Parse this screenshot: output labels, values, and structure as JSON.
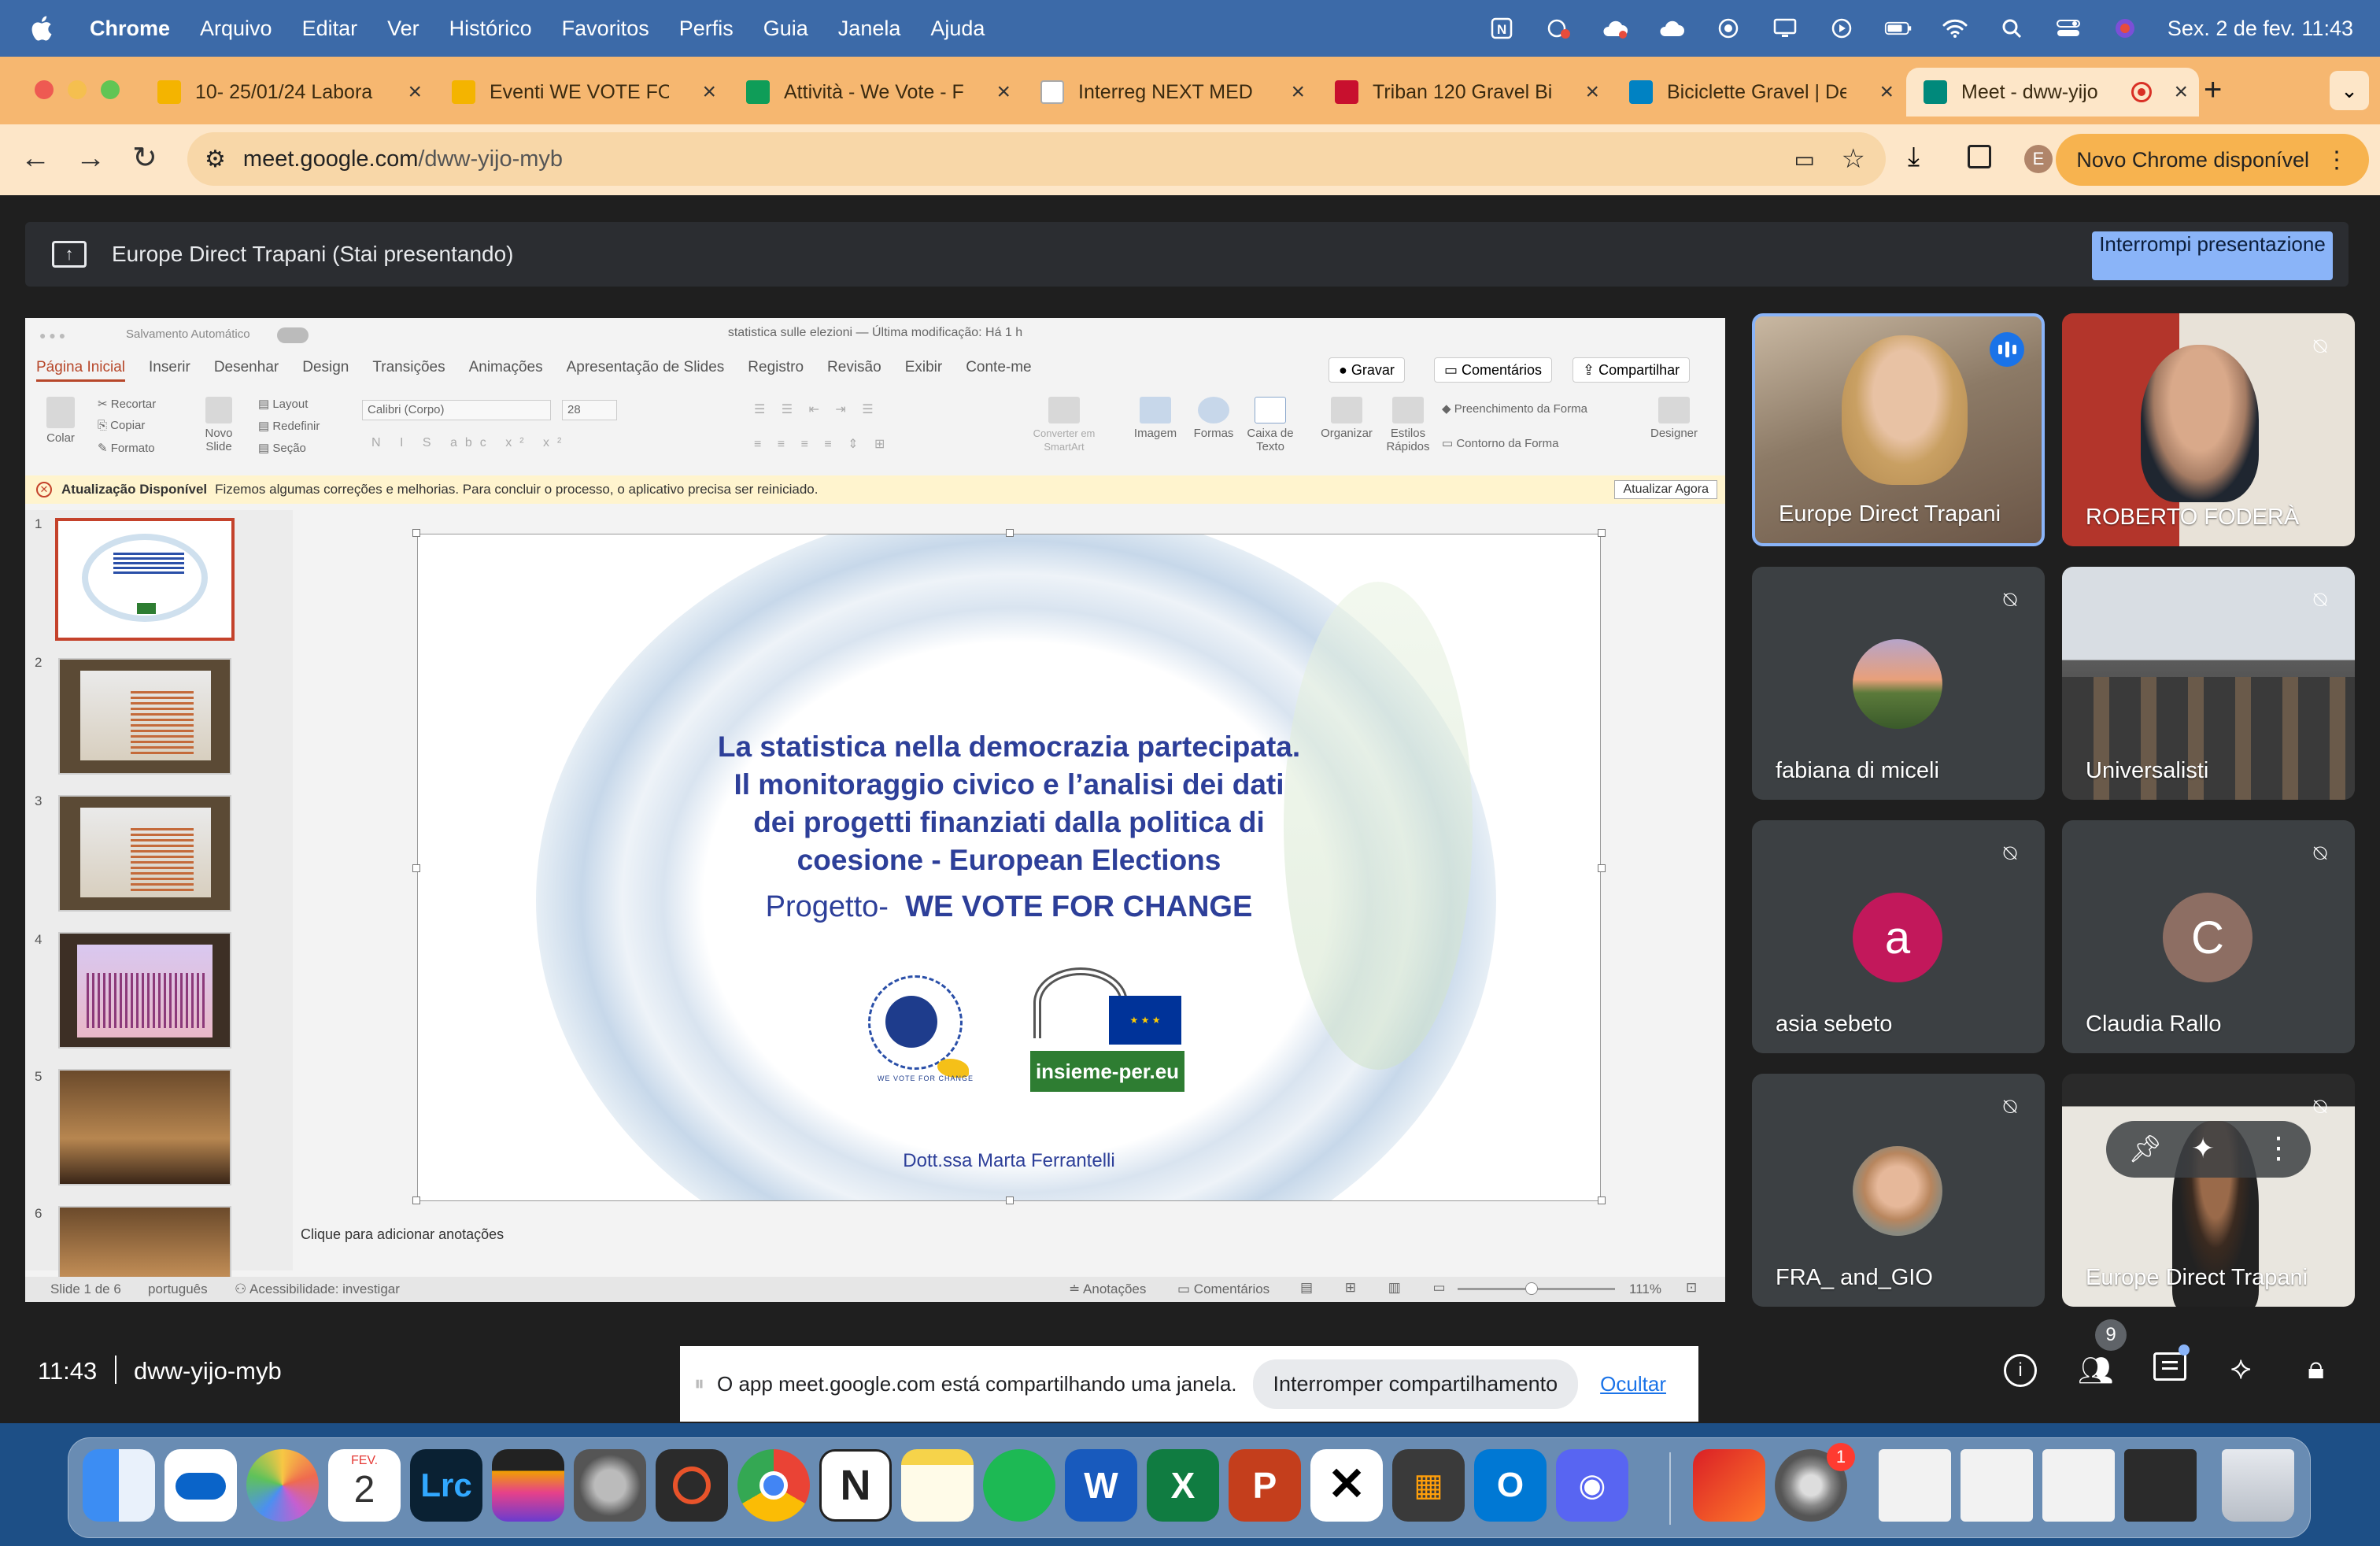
{
  "menubar": {
    "app": "Chrome",
    "items": [
      "Arquivo",
      "Editar",
      "Ver",
      "Histórico",
      "Favoritos",
      "Perfis",
      "Guia",
      "Janela",
      "Ajuda"
    ],
    "clock": "Sex. 2 de fev.  11:43"
  },
  "tabs": [
    {
      "title": "10- 25/01/24 Labora",
      "icon": "google-drive-icon",
      "color": "#f4b400"
    },
    {
      "title": "Eventi WE VOTE FOR",
      "icon": "google-drive-icon",
      "color": "#f4b400"
    },
    {
      "title": "Attività - We Vote - F",
      "icon": "google-sheets-icon",
      "color": "#0f9d58"
    },
    {
      "title": "Interreg NEXT MED",
      "icon": "web-icon",
      "color": "#dddddd"
    },
    {
      "title": "Triban 120 Gravel Bi",
      "icon": "brand-icon",
      "color": "#c8102e"
    },
    {
      "title": "Biciclette Gravel | De",
      "icon": "decathlon-icon",
      "color": "#0082c3"
    },
    {
      "title": "Meet - dww-yijo",
      "icon": "google-meet-icon",
      "color": "#00897b"
    }
  ],
  "address": {
    "host": "meet.google.com",
    "path": "/dww-yijo-myb"
  },
  "profile_initial": "E",
  "new_chrome": "Novo Chrome disponível",
  "presenting": {
    "label": "Europe Direct Trapani (Stai presentando)",
    "stop": "Interrompi presentazione"
  },
  "ppt": {
    "autosave": "Salvamento Automático",
    "title": "statistica sulle elezioni — Última modificação: Há 1 h",
    "tabs": [
      "Página Inicial",
      "Inserir",
      "Desenhar",
      "Design",
      "Transições",
      "Animações",
      "Apresentação de Slides",
      "Registro",
      "Revisão",
      "Exibir",
      "Conte-me"
    ],
    "gravar": "Gravar",
    "comentarios": "Comentários",
    "compartilhar": "Compartilhar",
    "ribbon": {
      "colar": "Colar",
      "recortar": "Recortar",
      "copiar": "Copiar",
      "formato": "Formato",
      "novo_slide": "Novo Slide",
      "layout": "Layout",
      "redefinir": "Redefinir",
      "secao": "Seção",
      "font": "Calibri (Corpo)",
      "size": "28",
      "converter": "Converter em SmartArt",
      "imagem": "Imagem",
      "formas": "Formas",
      "caixa": "Caixa de Texto",
      "organizar": "Organizar",
      "estilos": "Estilos Rápidos",
      "preenchimento": "Preenchimento da Forma",
      "contorno": "Contorno da Forma",
      "designer": "Designer"
    },
    "update_title": "Atualização Disponível",
    "update_msg": "Fizemos algumas correções e melhorias. Para concluir o processo, o aplicativo precisa ser reiniciado.",
    "update_btn": "Atualizar Agora",
    "thumb_nums": [
      "1",
      "2",
      "3",
      "4",
      "5",
      "6"
    ],
    "slide": {
      "line1": "La statistica nella democrazia partecipata.",
      "line2": "Il monitoraggio civico e l’analisi dei dati",
      "line3": "dei progetti finanziati dalla politica di",
      "line4": "coesione - European Elections",
      "progetto": "Progetto-",
      "project_name": "WE VOTE FOR CHANGE",
      "logo1": "WE VOTE FOR CHANGE",
      "logo2": "insieme-per.eu",
      "author": "Dott.ssa Marta Ferrantelli"
    },
    "notes": "Clique para adicionar anotações",
    "status": {
      "slide": "Slide 1 de 6",
      "lang": "português",
      "access": "Acessibilidade: investigar",
      "notes": "Anotações",
      "comments": "Comentários",
      "zoom": "111%"
    }
  },
  "participants": [
    {
      "name": "Europe Direct Trapani",
      "speaking": true
    },
    {
      "name": "ROBERTO FODERÀ"
    },
    {
      "name": "fabiana di miceli"
    },
    {
      "name": "Universalisti"
    },
    {
      "name": "asia sebeto",
      "initial": "a",
      "color": "#c2185b"
    },
    {
      "name": "Claudia Rallo",
      "initial": "C",
      "color": "#8d6e63"
    },
    {
      "name": "FRA_ and_GIO"
    },
    {
      "name": "Europe Direct Trapani"
    }
  ],
  "meeting": {
    "time": "11:43",
    "code": "dww-yijo-myb",
    "people_count": "9"
  },
  "share_notice": {
    "text": "O app meet.google.com está compartilhando uma janela.",
    "stop": "Interromper compartilhamento",
    "hide": "Ocultar"
  },
  "dock": {
    "calendar_month": "FEV.",
    "calendar_day": "2",
    "lrc": "Lrc",
    "settings_badge": "1"
  }
}
